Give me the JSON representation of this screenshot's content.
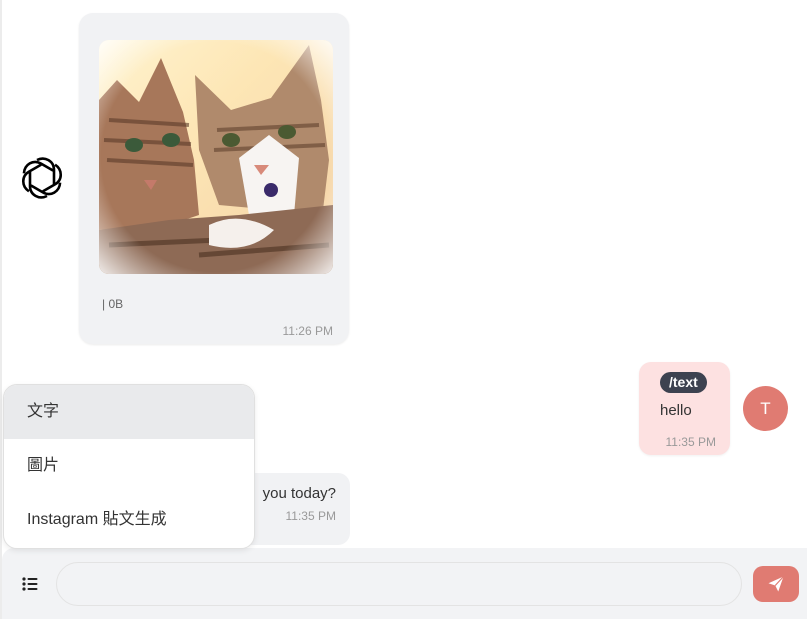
{
  "messages": {
    "image_message": {
      "caption": "| 0B",
      "time": "11:26 PM"
    },
    "user_message": {
      "command_tag": "/text",
      "text": "hello",
      "time": "11:35 PM",
      "avatar_initial": "T"
    },
    "bot_message": {
      "text": "you today?",
      "time": "11:35 PM"
    }
  },
  "menu": {
    "items": [
      {
        "label": "文字",
        "active": true
      },
      {
        "label": "圖片",
        "active": false
      },
      {
        "label": "Instagram 貼文生成",
        "active": false
      }
    ]
  },
  "composer": {
    "placeholder": "",
    "value": ""
  },
  "colors": {
    "accent": "#e07b72",
    "user_bubble": "#fde1e1",
    "bot_bubble": "#f1f2f4",
    "tag_bg": "#3d4250"
  },
  "icons": {
    "bot_avatar": "openai-logo-icon",
    "menu_button": "list-icon",
    "send_button": "paper-plane-icon"
  }
}
